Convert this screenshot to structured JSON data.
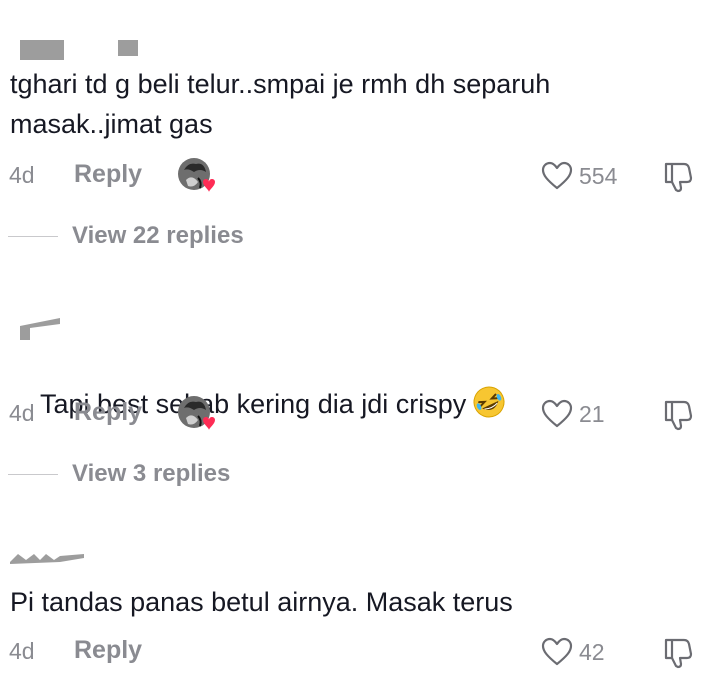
{
  "comments": [
    {
      "text": "tghari td g beli telur..smpai je rmh dh separuh masak..jimat gas",
      "time": "4d",
      "reply_label": "Reply",
      "likes": "554",
      "view_replies": "View 22 replies"
    },
    {
      "text": "Tapi best sebab kering dia jdi crispy",
      "emoji": "rolling-on-floor-laughing",
      "time": "4d",
      "reply_label": "Reply",
      "likes": "21",
      "view_replies": "View 3 replies"
    },
    {
      "text": "Pi tandas panas betul airnya. Masak terus",
      "time": "4d",
      "reply_label": "Reply",
      "likes": "42"
    }
  ],
  "colors": {
    "text": "#161823",
    "muted": "#8a8b91",
    "heart": "#fe2c55"
  },
  "icons": [
    "heart-outline-icon",
    "dislike-icon",
    "creator-liked-avatar-icon",
    "rolling-laughing-emoji-icon"
  ]
}
